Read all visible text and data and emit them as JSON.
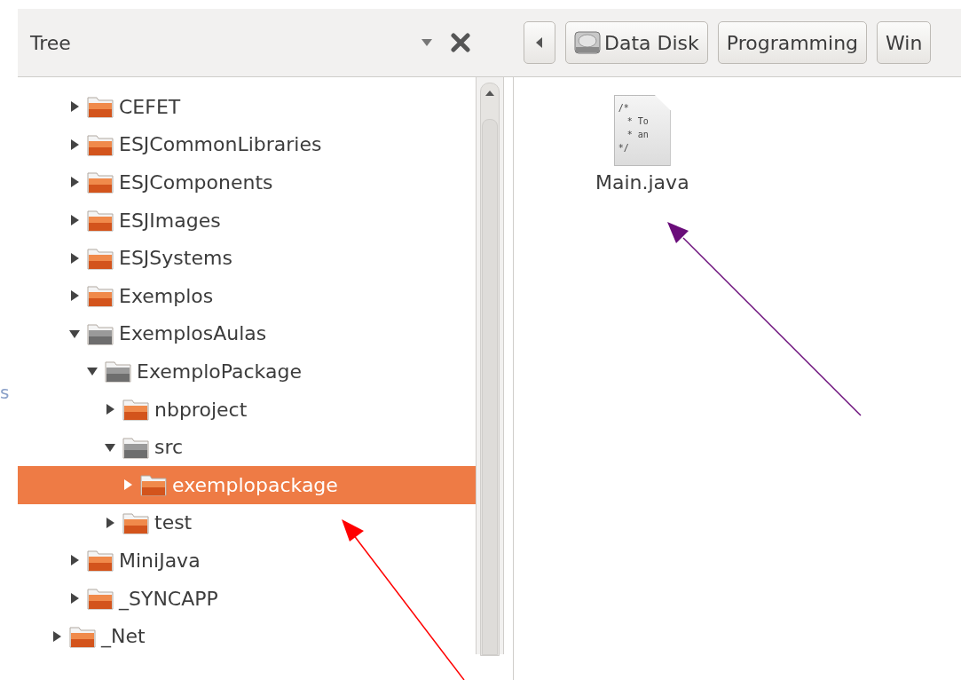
{
  "side_pane": {
    "title": "Tree"
  },
  "path_bar": {
    "buttons": [
      {
        "label": "Data Disk",
        "kind": "disk"
      },
      {
        "label": "Programming",
        "kind": "plain"
      },
      {
        "label": "Win",
        "kind": "plain"
      }
    ]
  },
  "left_edge_fragment": "s",
  "tree": [
    {
      "children": [
        {
          "label": "CEFET",
          "expanded": false,
          "selected": false
        },
        {
          "label": "ESJCommonLibraries",
          "expanded": false,
          "selected": false
        },
        {
          "label": "ESJComponents",
          "expanded": false,
          "selected": false
        },
        {
          "label": "ESJImages",
          "expanded": false,
          "selected": false
        },
        {
          "label": "ESJSystems",
          "expanded": false,
          "selected": false
        },
        {
          "label": "Exemplos",
          "expanded": false,
          "selected": false
        },
        {
          "label": "ExemplosAulas",
          "expanded": true,
          "selected": false,
          "children": [
            {
              "label": "ExemploPackage",
              "expanded": true,
              "selected": false,
              "children": [
                {
                  "label": "nbproject",
                  "expanded": false,
                  "selected": false
                },
                {
                  "label": "src",
                  "expanded": true,
                  "selected": false,
                  "children": [
                    {
                      "label": "exemplopackage",
                      "expanded": false,
                      "selected": true
                    }
                  ]
                },
                {
                  "label": "test",
                  "expanded": false,
                  "selected": false
                }
              ]
            }
          ]
        },
        {
          "label": "MiniJava",
          "expanded": false,
          "selected": false
        },
        {
          "label": "_SYNCAPP",
          "expanded": false,
          "selected": false
        }
      ]
    },
    {
      "label": "_Net",
      "expanded": false,
      "selected": false
    }
  ],
  "files": [
    {
      "name": "Main.java",
      "preview_lines": [
        "/*",
        "* To",
        "* an",
        "*/"
      ]
    }
  ],
  "annotations": [
    {
      "color": "#6a0d7a"
    },
    {
      "color": "#ff0000"
    }
  ]
}
